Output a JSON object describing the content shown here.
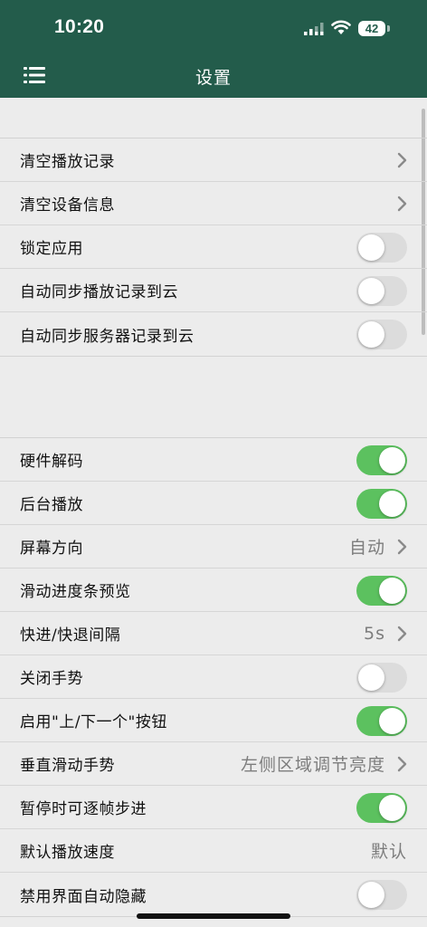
{
  "status_bar": {
    "time": "10:20",
    "battery": "42"
  },
  "header": {
    "title": "设置",
    "menu_icon": "list-menu-icon"
  },
  "group1": [
    {
      "label": "清空播放记录",
      "type": "nav"
    },
    {
      "label": "清空设备信息",
      "type": "nav"
    },
    {
      "label": "锁定应用",
      "type": "toggle",
      "on": false
    },
    {
      "label": "自动同步播放记录到云",
      "type": "toggle",
      "on": false
    },
    {
      "label": "自动同步服务器记录到云",
      "type": "toggle",
      "on": false
    }
  ],
  "group2": [
    {
      "label": "硬件解码",
      "type": "toggle",
      "on": true
    },
    {
      "label": "后台播放",
      "type": "toggle",
      "on": true
    },
    {
      "label": "屏幕方向",
      "type": "nav",
      "value": "自动"
    },
    {
      "label": "滑动进度条预览",
      "type": "toggle",
      "on": true
    },
    {
      "label": "快进/快退间隔",
      "type": "nav",
      "value": "5s"
    },
    {
      "label": "关闭手势",
      "type": "toggle",
      "on": false
    },
    {
      "label": "启用\"上/下一个\"按钮",
      "type": "toggle",
      "on": true
    },
    {
      "label": "垂直滑动手势",
      "type": "nav",
      "value": "左侧区域调节亮度"
    },
    {
      "label": "暂停时可逐帧步进",
      "type": "toggle",
      "on": true
    },
    {
      "label": "默认播放速度",
      "type": "value",
      "value": "默认"
    },
    {
      "label": "禁用界面自动隐藏",
      "type": "toggle",
      "on": false
    }
  ],
  "colors": {
    "header": "#235c4b",
    "toggle_on": "#5cc15f",
    "toggle_off": "#dcdcdc",
    "background": "#ececec"
  }
}
